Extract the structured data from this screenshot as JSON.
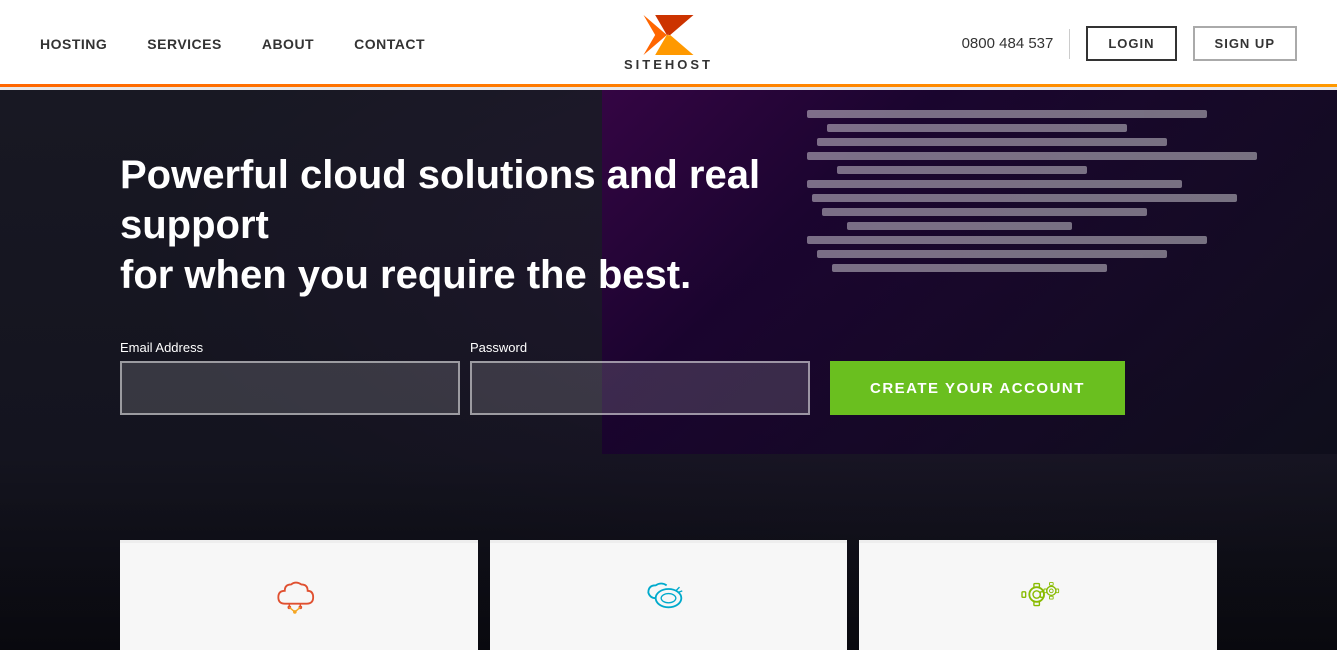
{
  "navbar": {
    "nav_items": [
      {
        "label": "HOSTING",
        "id": "hosting"
      },
      {
        "label": "SERVICES",
        "id": "services"
      },
      {
        "label": "ABOUT",
        "id": "about"
      },
      {
        "label": "CONTACT",
        "id": "contact"
      }
    ],
    "logo_text": "SITEHOST",
    "phone": "0800 484 537",
    "login_label": "LOGIN",
    "signup_label": "SIGN UP"
  },
  "hero": {
    "headline_line1": "Powerful cloud solutions and real support",
    "headline_line2": "for when you require the best.",
    "email_label": "Email Address",
    "email_placeholder": "",
    "password_label": "Password",
    "password_placeholder": "",
    "cta_label": "CREATE YOUR ACCOUNT"
  },
  "cards": [
    {
      "icon": "cloud",
      "id": "card-cloud"
    },
    {
      "icon": "tools",
      "id": "card-tools"
    },
    {
      "icon": "gear",
      "id": "card-gear"
    }
  ],
  "colors": {
    "cta_green": "#6abf1f",
    "accent_orange": "#f60",
    "nav_border": "#e8e8e8"
  }
}
